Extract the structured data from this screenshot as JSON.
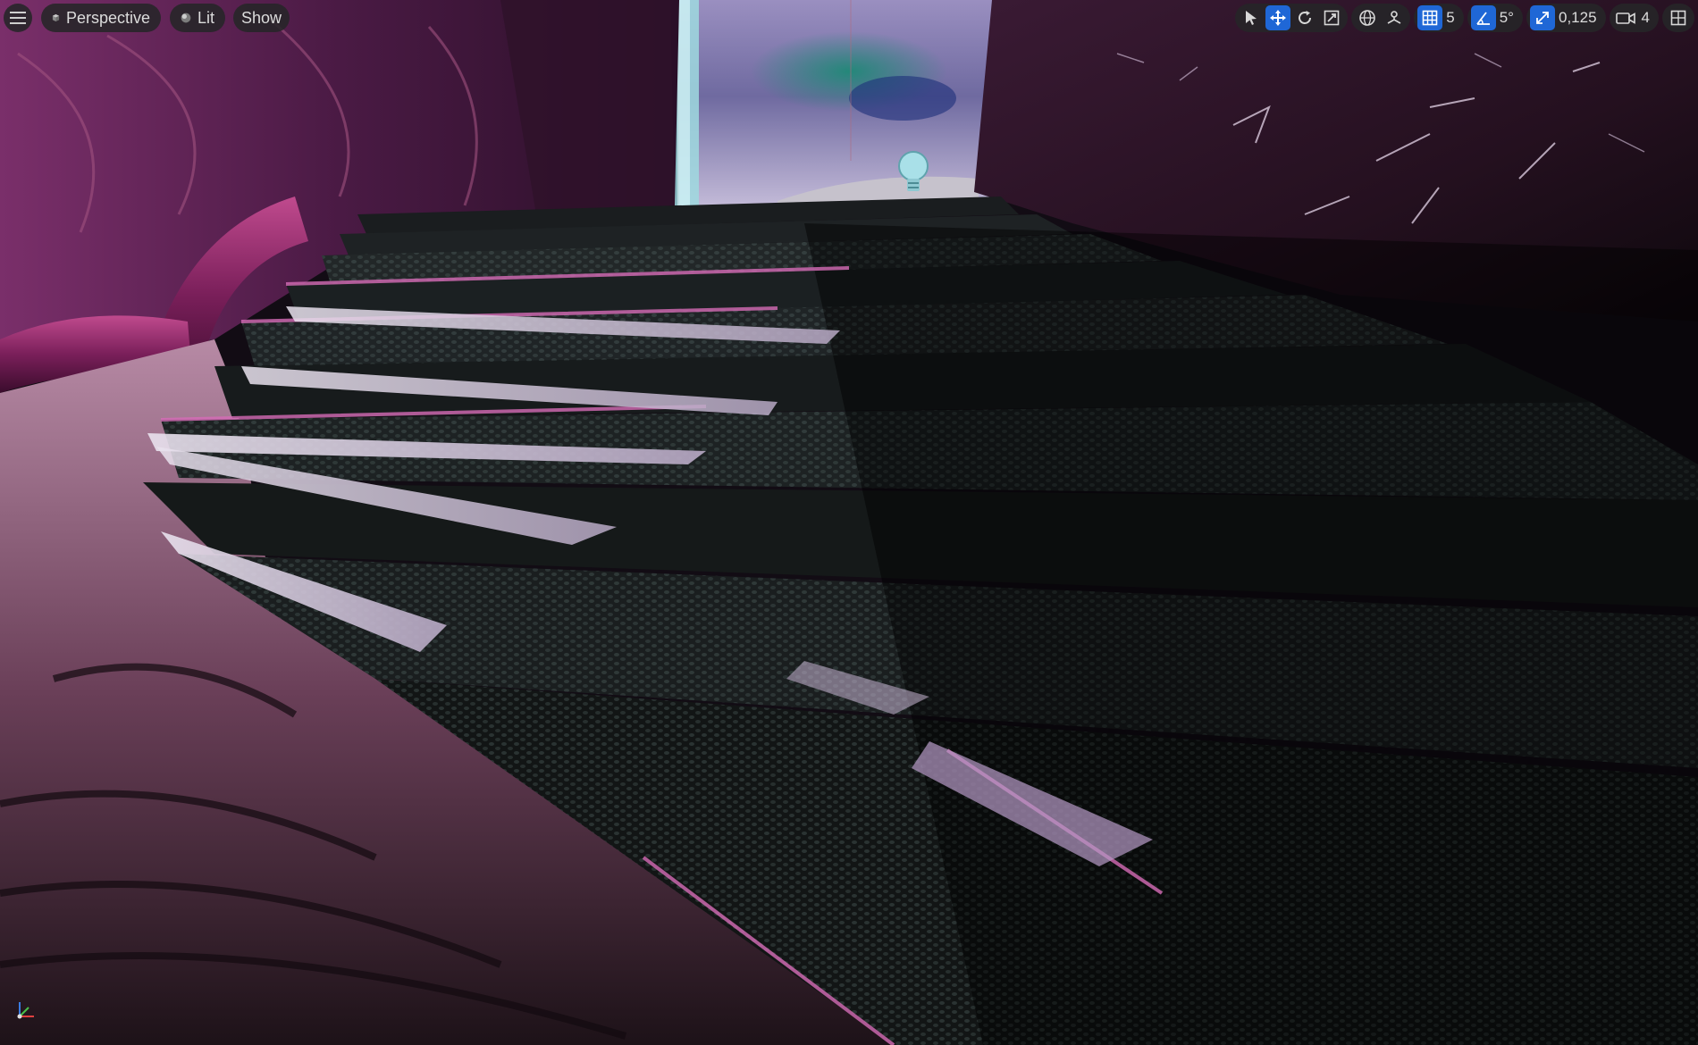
{
  "toolbar": {
    "menu_icon": "hamburger-icon",
    "view_mode": {
      "icon": "cube-icon",
      "label": "Perspective"
    },
    "lighting_mode": {
      "icon": "sphere-icon",
      "label": "Lit"
    },
    "show_label": "Show"
  },
  "transform_tools": {
    "select_icon": "cursor-icon",
    "move_icon": "move-arrows-icon",
    "rotate_icon": "rotate-icon",
    "scale_icon": "scale-icon",
    "active_tool": "move"
  },
  "coordinate_space_icon": "globe-icon",
  "surface_snapping_icon": "surface-snap-icon",
  "grid_snap": {
    "icon": "grid-icon",
    "value": "5"
  },
  "rotation_snap": {
    "icon": "angle-icon",
    "value": "5°"
  },
  "scale_snap": {
    "icon": "scale-snap-icon",
    "value": "0,125"
  },
  "camera_speed": {
    "icon": "camera-icon",
    "value": "4"
  },
  "layout_icon": "viewport-layout-icon",
  "colors": {
    "accent": "#1f67d6",
    "toolbar_bg": "#262628"
  }
}
